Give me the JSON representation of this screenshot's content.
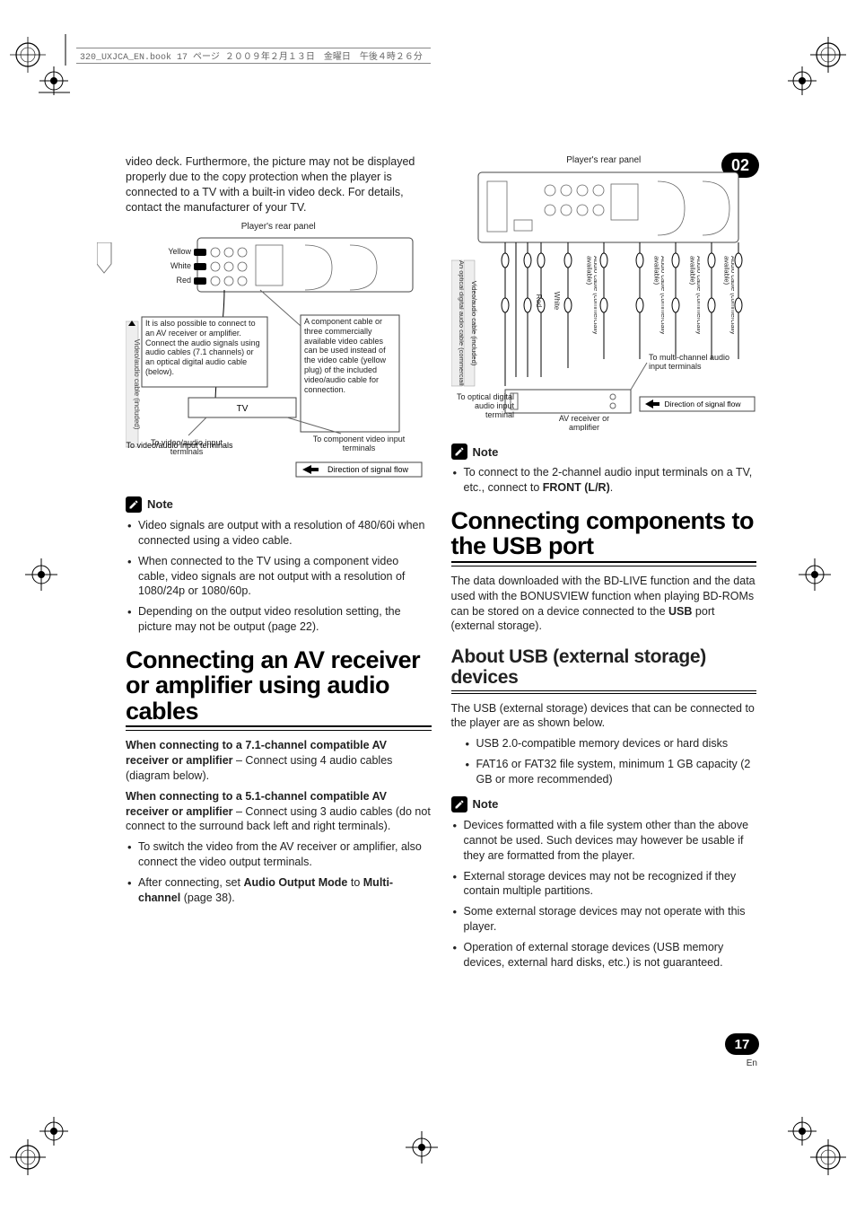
{
  "header": {
    "runner": "320_UXJCA_EN.book  17 ページ  ２００９年２月１３日　金曜日　午後４時２６分"
  },
  "badge": "02",
  "page_number": "17",
  "page_lang": "En",
  "left": {
    "intro_para": "video deck. Furthermore, the picture may not be displayed properly due to the copy protection when the player is connected to a TV with a built-in video deck. For details, contact the manufacturer of your TV.",
    "diagram1": {
      "caption": "Player's rear panel",
      "yellow": "Yellow",
      "white": "White",
      "red": "Red",
      "side_label": "Video/audio cable (included)",
      "left_note": "It is also possible to connect to an AV receiver or amplifier. Connect the audio signals using audio cables (7.1 channels) or an optical digital audio cable (below).",
      "tv_label": "TV",
      "to_va": "To video/audio input terminals",
      "right_note": "A component cable or three commercially available video cables can be used instead of the video cable (yellow plug) of the included video/audio cable for connection.",
      "to_comp": "To component video input terminals",
      "dir_flow": "Direction of signal flow"
    },
    "note_label": "Note",
    "note_items": [
      "Video signals are output with a resolution of 480/60i when connected using a video cable.",
      "When connected to the TV using a component video cable, video signals are not output with a resolution of 1080/24p or 1080/60p.",
      "Depending on the output video resolution setting, the picture may not be output (page 22)."
    ],
    "h1": "Connecting an AV receiver or amplifier using audio cables",
    "p71_a": "When connecting to a 7.1-channel compatible AV receiver or amplifier",
    "p71_b": " – Connect using 4 audio cables (diagram below).",
    "p51_a": "When connecting to a 5.1-channel compatible AV receiver or amplifier",
    "p51_b": " – Connect using 3 audio cables (do not connect to the surround back left and right terminals).",
    "sub_bullets_a1": "To switch the video from the AV receiver or amplifier, also connect the video output terminals.",
    "sub_bullets_a2a": "After connecting, set ",
    "sub_bullets_a2b": "Audio Output Mode",
    "sub_bullets_a2c": " to ",
    "sub_bullets_a2d": "Multi-channel",
    "sub_bullets_a2e": " (page 38)."
  },
  "right": {
    "diagram2": {
      "caption": "Player's rear panel",
      "optical": "An optical digital audio cable (commercially available) can also be used for connection.",
      "va_cable": "Video/audio cable (included)",
      "red": "Red",
      "white": "White",
      "audio_cable_comm": "Audio cable (commercially available)",
      "to_opt": "To optical digital audio input terminal",
      "av_receiver": "AV receiver or amplifier",
      "to_multi": "To multi-channel audio input terminals",
      "dir_flow": "Direction of signal flow"
    },
    "note_label": "Note",
    "note1_a": "To connect to the 2-channel audio input terminals on a TV, etc., connect to ",
    "note1_b": "FRONT (L/R)",
    "note1_c": ".",
    "h1": "Connecting components to the USB port",
    "p_usb_a": "The data downloaded with the BD-LIVE function and the data used with the BONUSVIEW function when playing BD-ROMs can be stored on a device connected to the ",
    "p_usb_b": "USB",
    "p_usb_c": " port (external storage).",
    "h2": "About USB (external storage) devices",
    "p_about": "The USB (external storage) devices that can be connected to the player are as shown below.",
    "usb_bullets": [
      "USB 2.0-compatible memory devices or hard disks",
      "FAT16 or FAT32 file system, minimum 1 GB capacity (2 GB or more recommended)"
    ],
    "note2_items": [
      "Devices formatted with a file system other than the above cannot be used. Such devices may however be usable if they are formatted from the player.",
      "External storage devices may not be recognized if they contain multiple partitions.",
      "Some external storage devices may not operate with this player.",
      "Operation of external storage devices (USB memory devices, external hard disks, etc.) is not guaranteed."
    ]
  }
}
